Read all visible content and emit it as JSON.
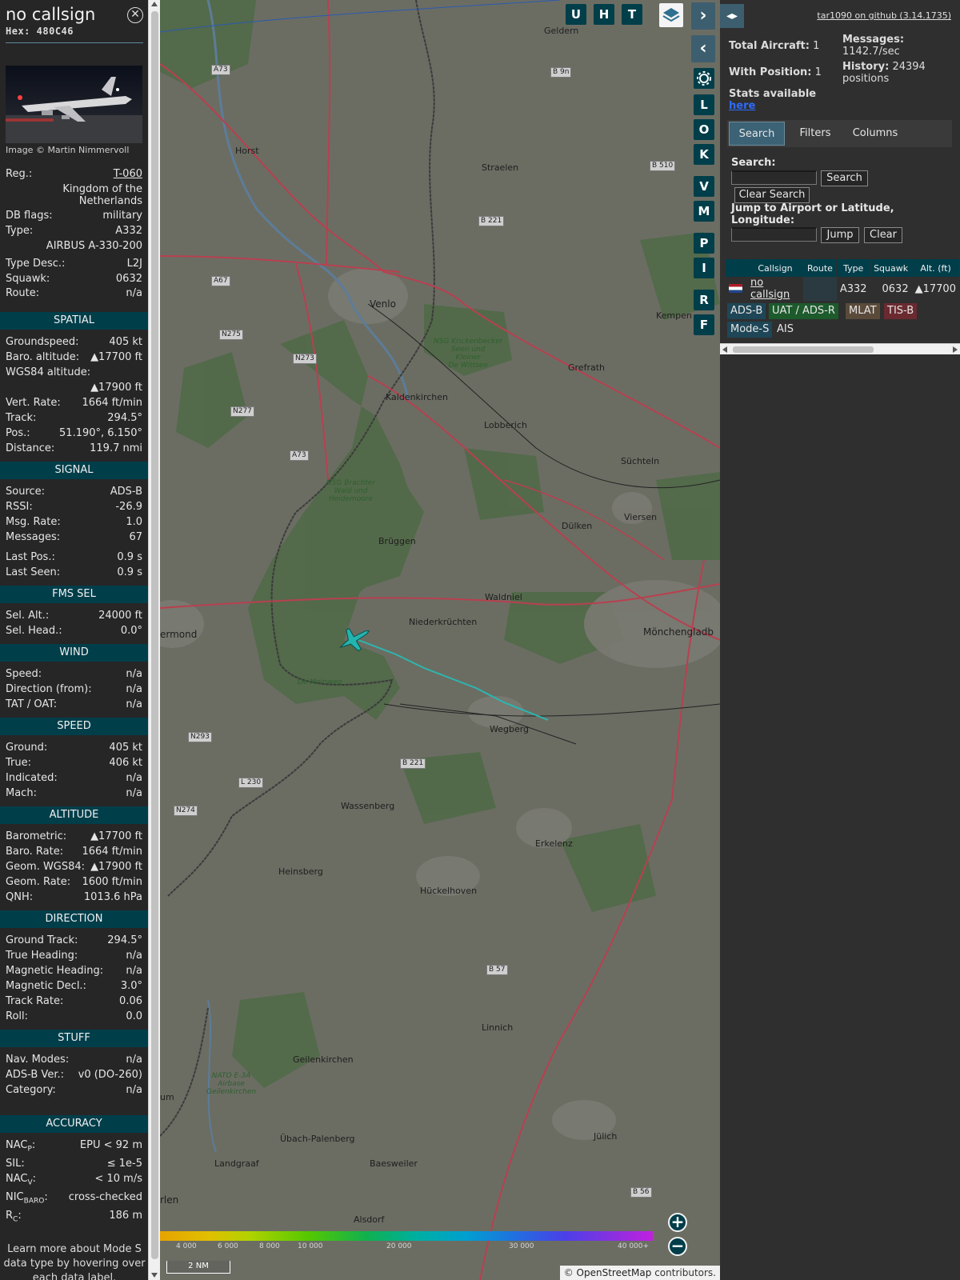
{
  "info": {
    "callsign": "no callsign",
    "hex_label": "Hex:",
    "hex": "480C46",
    "close_icon": "close-icon",
    "photo_credit": "Image © Martin Nimmervoll",
    "aircraft": {
      "reg_label": "Reg.:",
      "reg": "T-060",
      "country_line1": "Kingdom of the",
      "country_line2": "Netherlands",
      "dbflags_label": "DB flags:",
      "dbflags": "military",
      "type_label": "Type:",
      "type": "A332",
      "type_full": "AIRBUS A-330-200",
      "typedesc_label": "Type Desc.:",
      "typedesc": "L2J",
      "squawk_label": "Squawk:",
      "squawk": "0632",
      "route_label": "Route:",
      "route": "n/a"
    },
    "spatial": {
      "title": "SPATIAL",
      "groundspeed_label": "Groundspeed:",
      "groundspeed": "405 kt",
      "baro_alt_label": "Baro. altitude:",
      "baro_alt": "▲17700 ft",
      "wgs84_label": "WGS84 altitude:",
      "wgs84": "▲17900 ft",
      "vert_rate_label": "Vert. Rate:",
      "vert_rate": "1664 ft/min",
      "track_label": "Track:",
      "track": "294.5°",
      "pos_label": "Pos.:",
      "pos": "51.190°, 6.150°",
      "distance_label": "Distance:",
      "distance": "119.7 nmi"
    },
    "signal": {
      "title": "SIGNAL",
      "source_label": "Source:",
      "source": "ADS-B",
      "rssi_label": "RSSI:",
      "rssi": "-26.9",
      "msgrate_label": "Msg. Rate:",
      "msgrate": "1.0",
      "messages_label": "Messages:",
      "messages": "67",
      "lastpos_label": "Last Pos.:",
      "lastpos": "0.9 s",
      "lastseen_label": "Last Seen:",
      "lastseen": "0.9 s"
    },
    "fms": {
      "title": "FMS SEL",
      "selalt_label": "Sel. Alt.:",
      "selalt": "24000 ft",
      "selhead_label": "Sel. Head.:",
      "selhead": "0.0°"
    },
    "wind": {
      "title": "WIND",
      "speed_label": "Speed:",
      "speed": "n/a",
      "dir_label": "Direction (from):",
      "dir": "n/a",
      "tat_label": "TAT / OAT:",
      "tat": "n/a"
    },
    "speed": {
      "title": "SPEED",
      "ground_label": "Ground:",
      "ground": "405 kt",
      "true_label": "True:",
      "true": "406 kt",
      "indicated_label": "Indicated:",
      "indicated": "n/a",
      "mach_label": "Mach:",
      "mach": "n/a"
    },
    "altitude": {
      "title": "ALTITUDE",
      "baro_label": "Barometric:",
      "baro": "▲17700 ft",
      "barorate_label": "Baro. Rate:",
      "barorate": "1664 ft/min",
      "geom_label": "Geom. WGS84:",
      "geom": "▲17900 ft",
      "geomrate_label": "Geom. Rate:",
      "geomrate": "1600 ft/min",
      "qnh_label": "QNH:",
      "qnh": "1013.6 hPa"
    },
    "direction": {
      "title": "DIRECTION",
      "gtrack_label": "Ground Track:",
      "gtrack": "294.5°",
      "theading_label": "True Heading:",
      "theading": "n/a",
      "mheading_label": "Magnetic Heading:",
      "mheading": "n/a",
      "mdecl_label": "Magnetic Decl.:",
      "mdecl": "3.0°",
      "trackrate_label": "Track Rate:",
      "trackrate": "0.06",
      "roll_label": "Roll:",
      "roll": "0.0"
    },
    "stuff": {
      "title": "STUFF",
      "navmodes_label": "Nav. Modes:",
      "navmodes": "n/a",
      "adsbver_label": "ADS-B Ver.:",
      "adsbver": "v0 (DO-260)",
      "category_label": "Category:",
      "category": "n/a"
    },
    "accuracy": {
      "title": "ACCURACY",
      "nacp_label": "NAC",
      "nacp_sub": "P",
      "nacp": "EPU < 92 m",
      "sil_label": "SIL:",
      "sil": "≤ 1e-5",
      "nacv_label": "NAC",
      "nacv_sub": "V",
      "nacv": "< 10 m/s",
      "nicbaro_label": "NIC",
      "nicbaro_sub": "BARO",
      "nicbaro": "cross-checked",
      "rc_label": "R",
      "rc_sub": "C",
      "rc": "186 m"
    },
    "learn_more": "Learn more about Mode S data type by hovering over each data label."
  },
  "map": {
    "buttons_top": [
      "U",
      "H",
      "T"
    ],
    "layers_icon": "layers-icon",
    "side_buttons": [
      "L",
      "O",
      "K",
      "V",
      "M",
      "P",
      "I",
      "R",
      "F"
    ],
    "settings_icon": "gear-icon",
    "places": {
      "geldern": "Geldern",
      "horst": "Horst",
      "straelen": "Straelen",
      "venlo": "Venlo",
      "kempen": "Kempen",
      "grefrath": "Grefrath",
      "kaldenkirchen": "Kaldenkirchen",
      "lobberich": "Lobberich",
      "suchteln": "Süchteln",
      "viersen": "Viersen",
      "bruggen": "Brüggen",
      "dulken": "Dülken",
      "waldniel": "Waldniel",
      "niederkruchten": "Niederkrüchten",
      "roermond": "ermond",
      "monchengladbach": "Mönchengladb",
      "wegberg": "Wegberg",
      "wassenberg": "Wassenberg",
      "erkelenz": "Erkelenz",
      "heinsberg": "Heinsberg",
      "huckelhoven": "Hückelhoven",
      "linnich": "Linnich",
      "geilenkirchen": "Geilenkirchen",
      "julich": "Jülich",
      "ubach": "Übach-Palenberg",
      "baesweiler": "Baesweiler",
      "landgraaf": "Landgraaf",
      "alsdorf": "Alsdorf",
      "heerlen": "rlen",
      "aum": "um"
    },
    "roads": {
      "a73": "A73",
      "a73b": "A73",
      "a67": "A67",
      "n275": "N275",
      "n273": "N273",
      "n277": "N277",
      "n293": "N293",
      "l230": "L 230",
      "n274": "N274",
      "b221": "B 221",
      "b221b": "B 221",
      "b510": "B 510",
      "b9n": "B 9n",
      "b57": "B 57",
      "b56": "B 56"
    },
    "green": {
      "krickenbecker": "NSG Krickenbecker\nSeen und\nKleiner\nDe Wittsee",
      "brachter": "NSG Brachter\nWald und\nHeidemoore",
      "meinweg": "De Meinweg",
      "nato": "NATO E-3A\nAirbase\nGeilenkirchen"
    },
    "alt_ticks": [
      "4 000",
      "6 000",
      "8 000",
      "10 000",
      "20 000",
      "30 000",
      "40 000+"
    ],
    "scale_label": "2 NM",
    "zoom_in": "+",
    "zoom_out": "−",
    "attribution_prefix": "© ",
    "attribution_link": "OpenStreetMap",
    "attribution_suffix": " contributors."
  },
  "sidebar": {
    "toggle_icon": "expand-collapse-icon",
    "github": "tar1090 on github (3.14.1735)",
    "total_aircraft_label": "Total Aircraft:",
    "total_aircraft": "1",
    "with_position_label": "With Position:",
    "with_position": "1",
    "messages_label": "Messages:",
    "messages": "1142.7/sec",
    "history_label": "History:",
    "history": "24394 positions",
    "stats_label": "Stats available",
    "stats_link": "here",
    "tabs": [
      "Search",
      "Filters",
      "Columns"
    ],
    "search_label": "Search:",
    "search_button": "Search",
    "clear_search_button": "Clear Search",
    "jump_label": "Jump to Airport or Latitude, Longitude:",
    "jump_button": "Jump",
    "clear_button": "Clear",
    "table": {
      "headers": [
        "",
        "Callsign",
        "Route",
        "Type",
        "Squawk",
        "Alt. (ft)"
      ],
      "row": {
        "callsign": "no callsign",
        "route": "",
        "type": "A332",
        "squawk": "0632",
        "alt": "▲17700"
      }
    },
    "sources": [
      "ADS-B",
      "UAT / ADS-R",
      "MLAT",
      "TIS-B",
      "Mode-S",
      "AIS"
    ],
    "source_colors": [
      "#1e4656",
      "#1d5a2c",
      "#5a4a3a",
      "#6a2a30",
      "#1e4656",
      "#2f2f2f"
    ]
  }
}
